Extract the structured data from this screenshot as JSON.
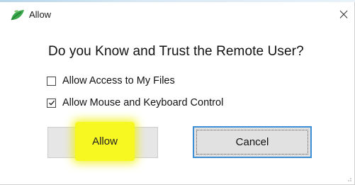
{
  "window": {
    "title": "Allow",
    "close_glyph": "×",
    "icon": "leaf-app-icon"
  },
  "prompt": {
    "question": "Do you Know and Trust the Remote User?"
  },
  "options": [
    {
      "label": "Allow Access to My Files",
      "checked": false
    },
    {
      "label": "Allow Mouse and Keyboard Control",
      "checked": true
    }
  ],
  "buttons": {
    "allow_label": "Allow",
    "cancel_label": "Cancel"
  },
  "colors": {
    "highlight": "#f7f722",
    "focus_border": "#3c8ed6",
    "button_face": "#e1e1e1",
    "icon_green": "#3aa84a"
  }
}
